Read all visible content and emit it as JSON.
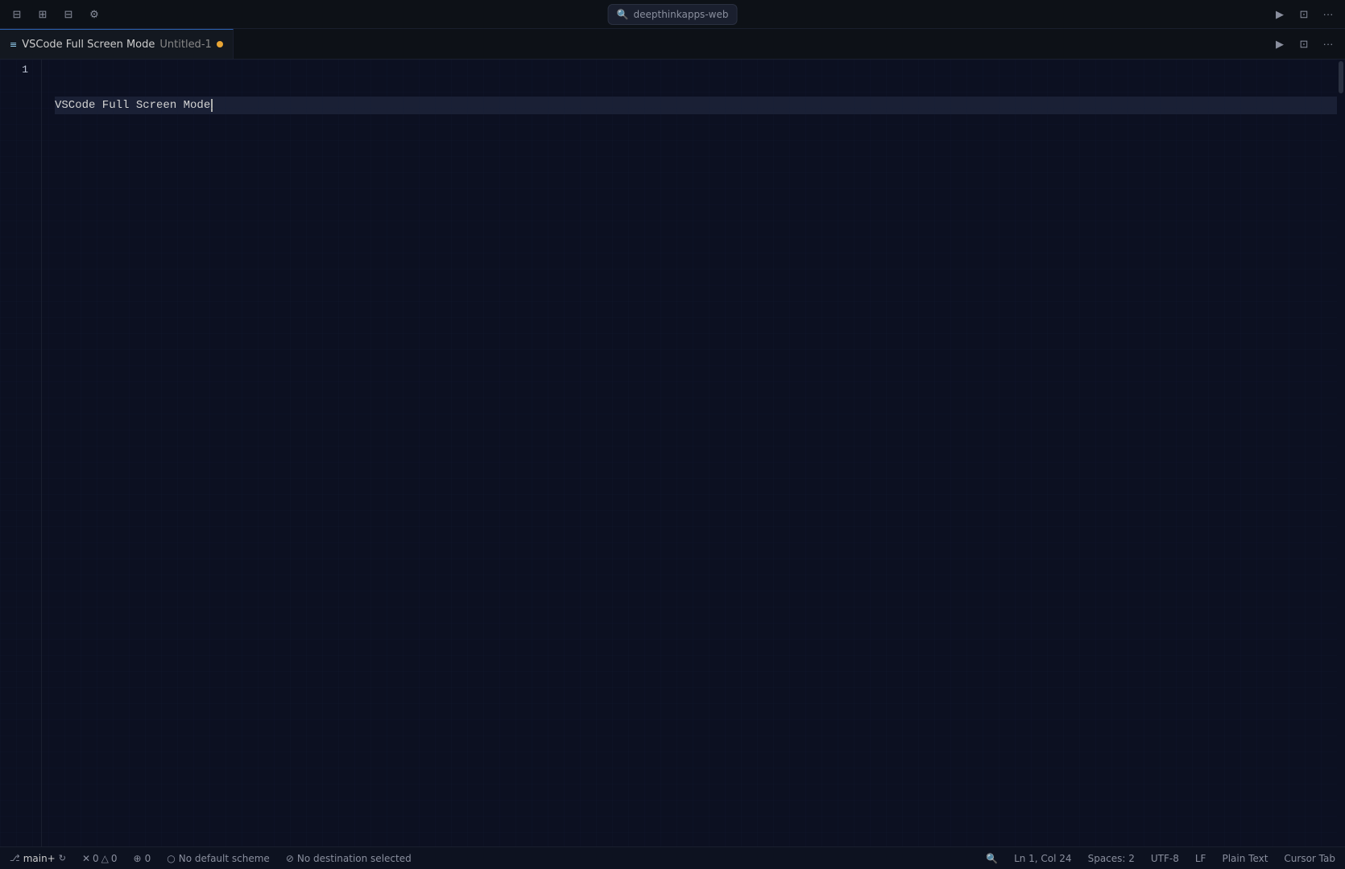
{
  "titlebar": {
    "search_placeholder": "deepthinkapps-web",
    "back_label": "←",
    "forward_label": "→",
    "icons": {
      "sidebar_icon": "⊟",
      "layout1_icon": "⊞",
      "layout2_icon": "⊟",
      "settings_icon": "⚙",
      "run_icon": "▶",
      "split_icon": "⊡",
      "more_icon": "···"
    }
  },
  "tabs": [
    {
      "icon": "≡",
      "name": "VSCode Full Screen Mode",
      "filename": "Untitled-1",
      "modified": true
    }
  ],
  "editor": {
    "lines": [
      {
        "number": 1,
        "content": "VSCode Full Screen Mode",
        "active": true
      }
    ]
  },
  "statusbar": {
    "branch": "main+",
    "sync_icon": "↻",
    "errors": "0",
    "warnings": "0",
    "info_icon": "⚠",
    "ports": "0",
    "no_scheme": "No default scheme",
    "no_dest": "No destination selected",
    "search_icon": "🔍",
    "ln_col": "Ln 1, Col 24",
    "spaces": "Spaces: 2",
    "encoding": "UTF-8",
    "line_ending": "LF",
    "language": "Plain Text",
    "cursor_tab": "Cursor Tab"
  }
}
